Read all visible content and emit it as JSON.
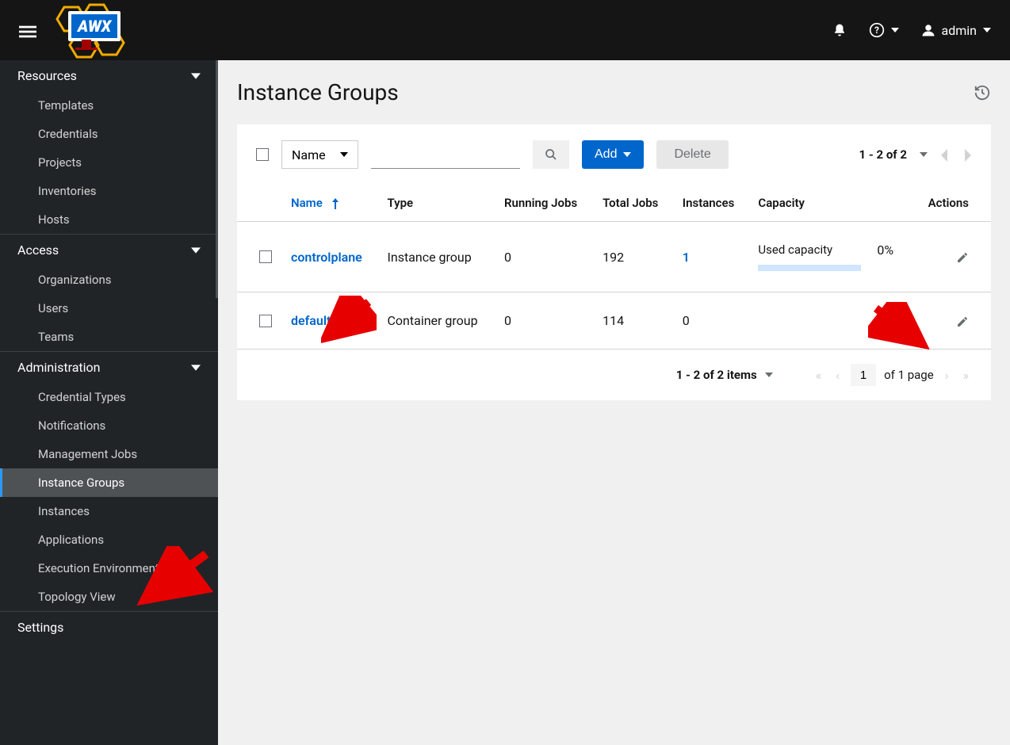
{
  "header": {
    "user_label": "admin"
  },
  "sidebar": {
    "sections": [
      {
        "label": "Resources",
        "items": [
          "Templates",
          "Credentials",
          "Projects",
          "Inventories",
          "Hosts"
        ]
      },
      {
        "label": "Access",
        "items": [
          "Organizations",
          "Users",
          "Teams"
        ]
      },
      {
        "label": "Administration",
        "items": [
          "Credential Types",
          "Notifications",
          "Management Jobs",
          "Instance Groups",
          "Instances",
          "Applications",
          "Execution Environments",
          "Topology View"
        ]
      },
      {
        "label": "Settings",
        "items": []
      }
    ],
    "active_item": "Instance Groups"
  },
  "page": {
    "title": "Instance Groups",
    "toolbar": {
      "filter_field": "Name",
      "add_label": "Add",
      "delete_label": "Delete",
      "pagination_top": "1 - 2 of 2"
    },
    "columns": {
      "name": "Name",
      "type": "Type",
      "running_jobs": "Running Jobs",
      "total_jobs": "Total Jobs",
      "instances": "Instances",
      "capacity": "Capacity",
      "actions": "Actions"
    },
    "rows": [
      {
        "name": "controlplane",
        "type": "Instance group",
        "running_jobs": "0",
        "total_jobs": "192",
        "instances": "1",
        "instances_link": true,
        "capacity_label": "Used capacity",
        "capacity_pct": "0%",
        "has_capacity": true
      },
      {
        "name": "default",
        "type": "Container group",
        "running_jobs": "0",
        "total_jobs": "114",
        "instances": "0",
        "instances_link": false,
        "has_capacity": false
      }
    ],
    "pagination_bottom": {
      "summary": "1 - 2 of 2 items",
      "page_input": "1",
      "of_pages": "of 1 page"
    }
  }
}
